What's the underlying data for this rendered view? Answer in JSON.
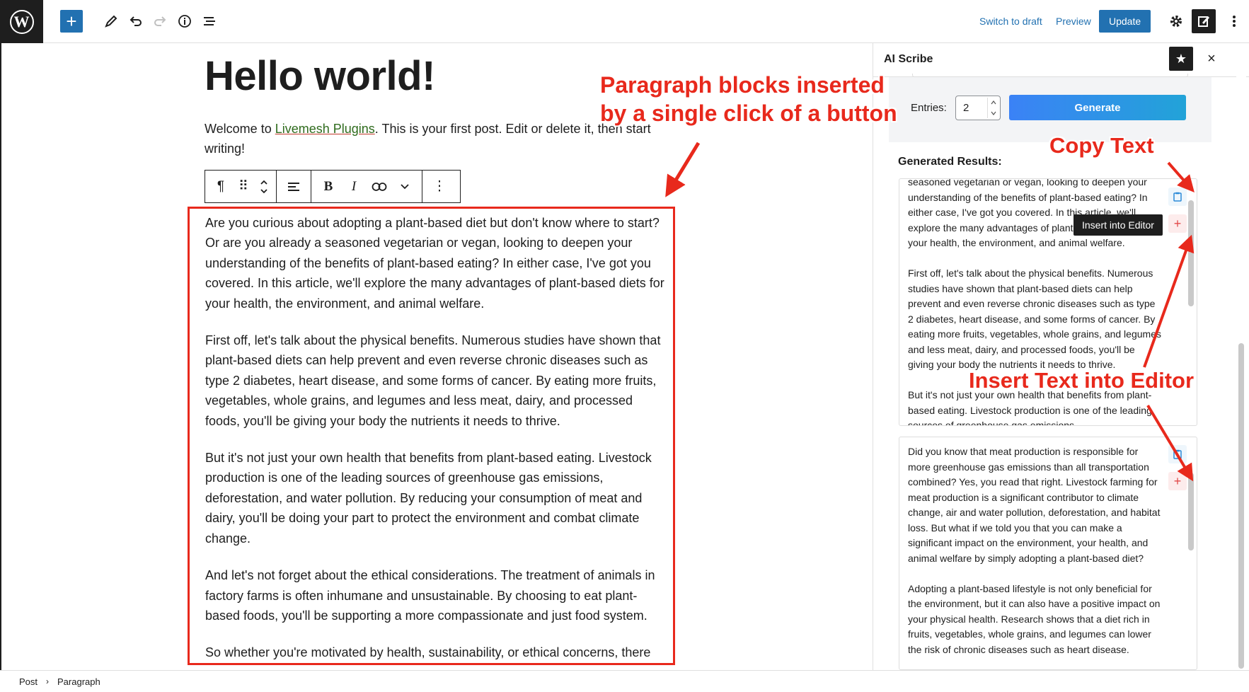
{
  "topbar": {
    "logo": "W",
    "add_icon": "+",
    "switch_to_draft": "Switch to draft",
    "preview": "Preview",
    "update": "Update"
  },
  "editor": {
    "title": "Hello world!",
    "intro_before": "Welcome to ",
    "intro_link": "Livemesh Plugins",
    "intro_after": ". This is your first post. Edit or delete it, then start writing!",
    "toolbar": {
      "paragraph_icon": "¶",
      "drag_icon": "⠿",
      "align_icon": "≡",
      "bold": "B",
      "italic": "I",
      "more_icon": "⋮"
    },
    "paragraphs": [
      "Are you curious about adopting a plant-based diet but don't know where to start? Or are you already a seasoned vegetarian or vegan, looking to deepen your understanding of the benefits of plant-based eating? In either case, I've got you covered. In this article, we'll explore the many advantages of plant-based diets for your health, the environment, and animal welfare.",
      "First off, let's talk about the physical benefits. Numerous studies have shown that plant-based diets can help prevent and even reverse chronic diseases such as type 2 diabetes, heart disease, and some forms of cancer. By eating more fruits, vegetables, whole grains, and legumes and less meat, dairy, and processed foods, you'll be giving your body the nutrients it needs to thrive.",
      "But it's not just your own health that benefits from plant-based eating. Livestock production is one of the leading sources of greenhouse gas emissions, deforestation, and water pollution. By reducing your consumption of meat and dairy, you'll be doing your part to protect the environment and combat climate change.",
      "And let's not forget about the ethical considerations. The treatment of animals in factory farms is often inhumane and unsustainable. By choosing to eat plant-based foods, you'll be supporting a more compassionate and just food system.",
      "So whether you're motivated by health, sustainability, or ethical concerns, there are plenty of reasons to consider adopting a plant-based diet. Give it a try today!"
    ]
  },
  "annotations": {
    "paragraph_line1": "Paragraph blocks inserted",
    "paragraph_line2": "by a single click of a button",
    "copy_text": "Copy Text",
    "insert_text": "Insert Text into Editor",
    "color": "#e8291c"
  },
  "sidebar": {
    "title": "AI Scribe",
    "star_icon": "★",
    "close_icon": "×",
    "entries_label": "Entries:",
    "entries_value": "2",
    "generate_label": "Generate",
    "results_title": "Generated Results:",
    "tooltip": "Insert into Editor",
    "copy_icon": "📋",
    "insert_icon": "+",
    "result1": [
      "seasoned vegetarian or vegan, looking to deepen your understanding of the benefits of plant-based eating? In either case, I've got you covered. In this article, we'll explore the many advantages of plant-based diets for your health, the environment, and animal welfare.",
      "First off, let's talk about the physical benefits. Numerous studies have shown that plant-based diets can help prevent and even reverse chronic diseases such as type 2 diabetes, heart disease, and some forms of cancer. By eating more fruits, vegetables, whole grains, and legumes and less meat, dairy, and processed foods, you'll be giving your body the nutrients it needs to thrive.",
      "But it's not just your own health that benefits from plant-based eating. Livestock production is one of the leading sources of greenhouse gas emissions."
    ],
    "result2": [
      "Did you know that meat production is responsible for more greenhouse gas emissions than all transportation combined? Yes, you read that right. Livestock farming for meat production is a significant contributor to climate change, air and water pollution, deforestation, and habitat loss. But what if we told you that you can make a significant impact on the environment, your health, and animal welfare by simply adopting a plant-based diet?",
      "Adopting a plant-based lifestyle is not only beneficial for the environment, but it can also have a positive impact on your physical health. Research shows that a diet rich in fruits, vegetables, whole grains, and legumes can lower the risk of chronic diseases such as heart disease."
    ]
  },
  "footer": {
    "crumb1": "Post",
    "separator": "›",
    "crumb2": "Paragraph"
  }
}
